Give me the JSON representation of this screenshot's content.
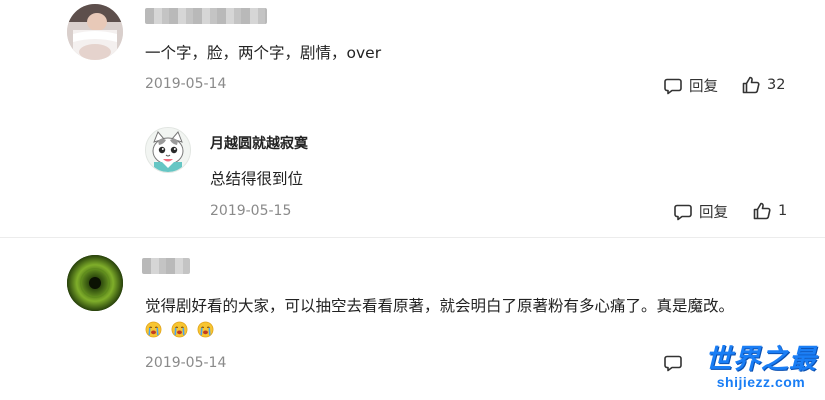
{
  "comments": [
    {
      "name": "",
      "text": "一个字，脸，两个字，剧情，over",
      "date": "2019-05-14",
      "reply_label": "回复",
      "likes": "32",
      "avatar_icon": "person-avatar-icon"
    },
    {
      "name": "月越圆就越寂寞",
      "text": "总结得很到位",
      "date": "2019-05-15",
      "reply_label": "回复",
      "likes": "1",
      "avatar_icon": "cat-avatar-icon"
    },
    {
      "name": "",
      "text": "觉得剧好看的大家，可以抽空去看看原著，就会明白了原著粉有多心痛了。真是魔改。",
      "emojis": [
        "crying-emoji",
        "crying-emoji",
        "crying-emoji"
      ],
      "date": "2019-05-14",
      "reply_label": "回复",
      "avatar_icon": "green-eye-avatar-icon"
    }
  ],
  "watermark": {
    "cn": "世界之最",
    "en": "shijiezz.com"
  },
  "colors": {
    "text": "#222222",
    "date": "#8a8a8a",
    "watermark": "#1a7ef5"
  }
}
